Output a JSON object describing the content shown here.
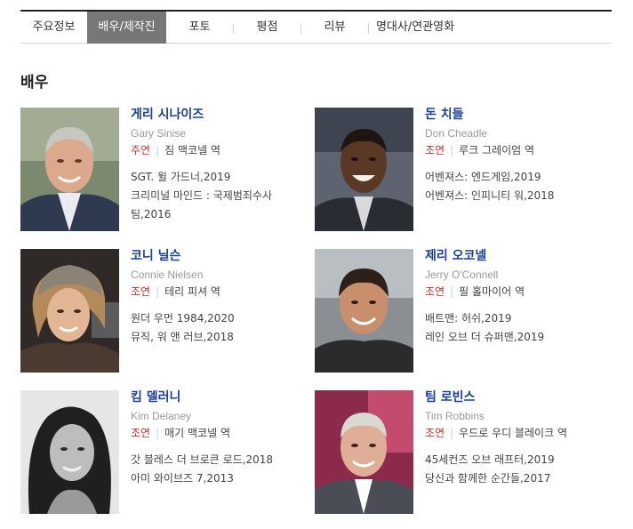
{
  "tabs": [
    {
      "label": "주요정보",
      "active": false
    },
    {
      "label": "배우/제작진",
      "active": true
    },
    {
      "label": "포토",
      "active": false
    },
    {
      "label": "평점",
      "active": false
    },
    {
      "label": "리뷰",
      "active": false
    },
    {
      "label": "명대사/연관영화",
      "active": false
    }
  ],
  "section_title": "배우",
  "actors": [
    {
      "name": "게리 시나이즈",
      "english_name": "Gary Sinise",
      "role_type": "주연",
      "role": "짐 맥코넬 역",
      "works": [
        "SGT. 윌 가드너,2019",
        "크리미널 마인드 : 국제범죄수사팀,2016"
      ]
    },
    {
      "name": "돈 치들",
      "english_name": "Don Cheadle",
      "role_type": "조연",
      "role": "루크 그레이엄 역",
      "works": [
        "어벤져스: 엔드게임,2019",
        "어벤져스: 인피니티 워,2018"
      ]
    },
    {
      "name": "코니 닐슨",
      "english_name": "Connie Nielsen",
      "role_type": "조연",
      "role": "테리 피셔 역",
      "works": [
        "원더 우먼 1984,2020",
        "뮤직, 워 앤 러브,2018"
      ]
    },
    {
      "name": "제리 오코넬",
      "english_name": "Jerry O'Connell",
      "role_type": "조연",
      "role": "필 홀마이어 역",
      "works": [
        "배트맨: 허쉬,2019",
        "레인 오브 더 슈퍼맨,2019"
      ]
    },
    {
      "name": "킴 델러니",
      "english_name": "Kim Delaney",
      "role_type": "조연",
      "role": "매기 맥코넬 역",
      "works": [
        "갓 블레스 더 브로큰 로드,2018",
        "아미 와이브즈 7,2013"
      ]
    },
    {
      "name": "팀 로빈스",
      "english_name": "Tim Robbins",
      "role_type": "조연",
      "role": "우드로 우디 블레이크 역",
      "works": [
        "45세컨즈 오브 래프터,2019",
        "당신과 함께한 순간들,2017"
      ]
    }
  ]
}
